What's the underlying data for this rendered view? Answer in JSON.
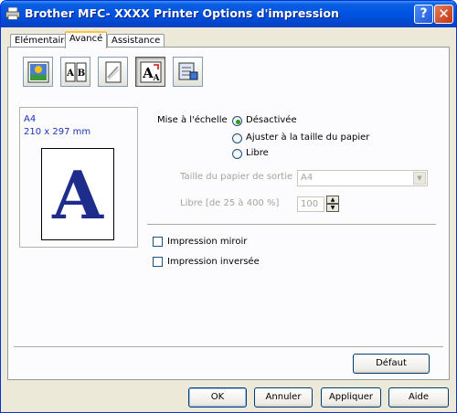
{
  "window": {
    "title": "Brother  MFC- XXXX   Printer Options d'impression",
    "help_label": "?",
    "close_label": "✕"
  },
  "tabs": [
    {
      "label": "Elémentaire",
      "active": false
    },
    {
      "label": "Avancé",
      "active": true
    },
    {
      "label": "Assistance",
      "active": false
    }
  ],
  "toolbar_icons": [
    {
      "name": "color-quality-icon",
      "selected": false
    },
    {
      "name": "duplex-ab-icon",
      "selected": false
    },
    {
      "name": "watermark-icon",
      "selected": false
    },
    {
      "name": "scaling-icon",
      "selected": true
    },
    {
      "name": "device-options-icon",
      "selected": false
    }
  ],
  "preview": {
    "paper_size": "A4",
    "dimensions": "210 x 297 mm",
    "letter": "A"
  },
  "scaling": {
    "label": "Mise à l'échelle",
    "options": [
      {
        "label": "Désactivée",
        "checked": true
      },
      {
        "label": "Ajuster à la taille du papier",
        "checked": false
      },
      {
        "label": "Libre",
        "checked": false
      }
    ],
    "output_paper_label": "Taille du papier de sortie",
    "output_paper_value": "A4",
    "free_label": "Libre [de 25 à 400 %]",
    "free_value": "100"
  },
  "checkboxes": [
    {
      "label": "Impression miroir",
      "checked": false
    },
    {
      "label": "Impression inversée",
      "checked": false
    }
  ],
  "buttons": {
    "default": "Défaut",
    "ok": "OK",
    "cancel": "Annuler",
    "apply": "Appliquer",
    "help": "Aide"
  }
}
